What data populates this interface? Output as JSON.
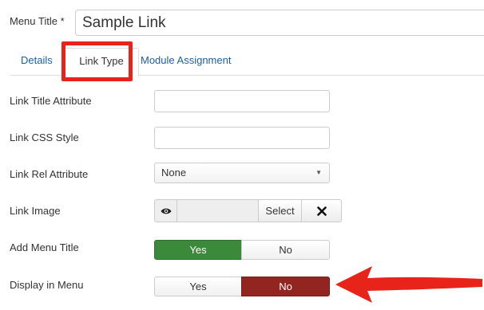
{
  "menu_title": {
    "label": "Menu Title *",
    "value": "Sample Link"
  },
  "tabs": [
    {
      "label": "Details"
    },
    {
      "label": "Link Type"
    },
    {
      "label": "Module Assignment"
    }
  ],
  "fields": {
    "link_title_attribute": {
      "label": "Link Title Attribute",
      "value": ""
    },
    "link_css_style": {
      "label": "Link CSS Style",
      "value": ""
    },
    "link_rel_attribute": {
      "label": "Link Rel Attribute",
      "selected": "None"
    },
    "link_image": {
      "label": "Link Image",
      "select_label": "Select"
    },
    "add_menu_title": {
      "label": "Add Menu Title",
      "yes": "Yes",
      "no": "No",
      "value": "Yes"
    },
    "display_in_menu": {
      "label": "Display in Menu",
      "yes": "Yes",
      "no": "No",
      "value": "No"
    }
  },
  "colors": {
    "highlight": "#e8231a",
    "yes_active": "#3b8a3b",
    "no_active": "#922520",
    "tab_link": "#1f5fa0"
  },
  "icons": {
    "preview": "eye-icon",
    "clear": "x-mark-icon",
    "dropdown": "caret-down-icon"
  }
}
